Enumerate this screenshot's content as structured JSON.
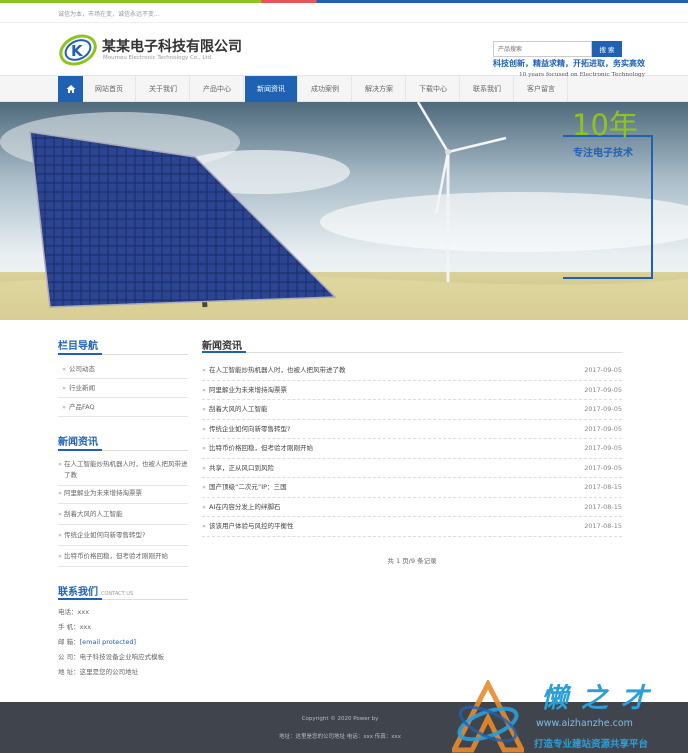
{
  "topbar": {
    "slogan": "诚信为本，市场在变，诚信永远不变..."
  },
  "brand": {
    "name": "某某电子科技有限公司",
    "sub": "Moumou Electronic Technology Co., Ltd."
  },
  "search": {
    "placeholder": "产品搜索",
    "button": "搜 索"
  },
  "nav": {
    "home_icon": "home-icon",
    "items": [
      "网站首页",
      "关于我们",
      "产品中心",
      "新闻资讯",
      "成功案例",
      "解决方案",
      "下载中心",
      "联系我们",
      "客户留言"
    ],
    "active": "新闻资讯"
  },
  "banner": {
    "line1": "科技创新，精益求精，开拓进取，务实高效",
    "line2": "10 years focused on Electronic Technology",
    "big": "10年",
    "sub": "专注电子技术"
  },
  "sidebar": {
    "nav_title": "栏目导航",
    "categories": [
      "公司动态",
      "行业新闻",
      "产品FAQ"
    ],
    "news_title": "新闻资讯",
    "news": [
      "在人工智能炒热机器人时，也被人把风带进了教",
      "阿里解业为未来增持淘票票",
      "刮着大风的人工智能",
      "传统企业如何向新零售转型?",
      "比特币价格回稳，但考验才刚刚开始"
    ],
    "contact_title": "联系我们",
    "contact_sub": "CONTACT US",
    "contact": {
      "phone_label": "电话：",
      "phone": "xxx",
      "mobile_label": "手 机：",
      "mobile": "xxx",
      "email_label": "邮 箱：",
      "email": "[email protected]",
      "company_label": "公 司：",
      "company": "电子科技设备企业响应式模板",
      "address_label": "地 址：",
      "address": "这里是您的公司地址"
    }
  },
  "main": {
    "title": "新闻资讯",
    "news": [
      {
        "title": "在人工智能炒热机器人时，也被人把风带进了教",
        "date": "2017-09-05"
      },
      {
        "title": "阿里解业为未来增持淘票票",
        "date": "2017-09-05"
      },
      {
        "title": "刮着大风的人工智能",
        "date": "2017-09-05"
      },
      {
        "title": "传统企业如何向新零售转型?",
        "date": "2017-09-05"
      },
      {
        "title": "比特币价格回稳，但考验才刚刚开始",
        "date": "2017-09-05"
      },
      {
        "title": "共享，正从风口到风险",
        "date": "2017-09-05"
      },
      {
        "title": "国产顶级“二次元”IP：三国",
        "date": "2017-08-15"
      },
      {
        "title": "AI在内容分发上的绊脚石",
        "date": "2017-08-15"
      },
      {
        "title": "该该用户体验与风控的平衡性",
        "date": "2017-08-15"
      }
    ],
    "pager": "共 1 页/9 条记录"
  },
  "footer": {
    "copyright": "Copyright © 2020 Power by",
    "address_line": "地址：这里是您的公司地址  电话：xxx  传真：xxx"
  },
  "watermark": {
    "brand": "懒之才",
    "url": "www.aizhanzhe.com",
    "slogan": "打造专业建站资源共享平台"
  },
  "colors": {
    "accent": "#1f62b3",
    "green": "#8fc31f",
    "footer": "#40454d"
  }
}
